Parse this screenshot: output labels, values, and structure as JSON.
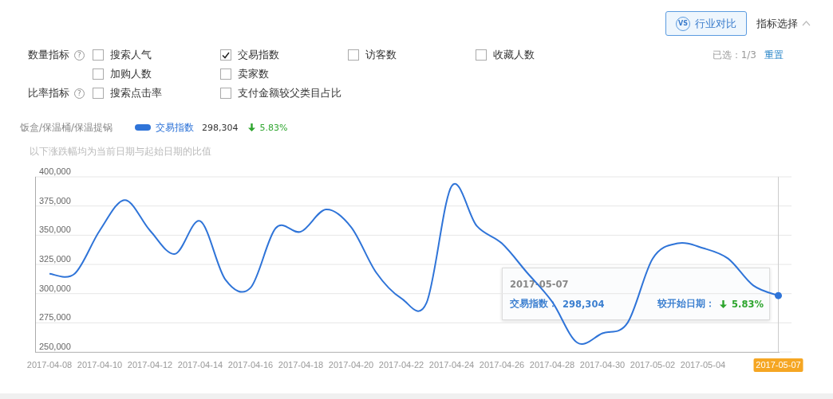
{
  "toolbar": {
    "compare_button": {
      "badge": "VS",
      "label": "行业对比"
    },
    "metric_toggle": {
      "label": "指标选择",
      "expanded": true
    }
  },
  "metric_groups": [
    {
      "label": "数量指标",
      "help": "?",
      "items": [
        {
          "label": "搜索人气",
          "checked": false
        },
        {
          "label": "交易指数",
          "checked": true
        },
        {
          "label": "访客数",
          "checked": false
        },
        {
          "label": "收藏人数",
          "checked": false
        },
        {
          "label": "加购人数",
          "checked": false
        },
        {
          "label": "卖家数",
          "checked": false
        }
      ]
    },
    {
      "label": "比率指标",
      "help": "?",
      "items": [
        {
          "label": "搜索点击率",
          "checked": false
        },
        {
          "label": "支付金额较父类目占比",
          "checked": false
        }
      ]
    }
  ],
  "selection": {
    "count": "已选：1/3",
    "reset": "重置"
  },
  "legend": {
    "category": "饭盒/保温桶/保温提锅",
    "value": "298,304",
    "change": "5.83%",
    "falling": true
  },
  "note": "以下涨跌幅均为当前日期与起始日期的比值",
  "chart_data": {
    "type": "line",
    "categories": [
      "2017-04-08",
      null,
      "2017-04-10",
      null,
      "2017-04-12",
      null,
      "2017-04-14",
      null,
      "2017-04-16",
      null,
      "2017-04-18",
      null,
      "2017-04-20",
      null,
      "2017-04-22",
      null,
      "2017-04-24",
      null,
      "2017-04-26",
      null,
      "2017-04-28",
      null,
      "2017-04-30",
      null,
      "2017-05-02",
      null,
      "2017-05-04",
      null,
      null,
      "2017-05-07"
    ],
    "grid": true,
    "series": [
      {
        "name": "交易指数",
        "color": "#2f74d8",
        "values": [
          317000,
          317000,
          354000,
          380000,
          354000,
          334000,
          362000,
          312000,
          305000,
          356000,
          353000,
          372000,
          357000,
          318000,
          296000,
          292000,
          392000,
          358000,
          343000,
          318000,
          293000,
          258000,
          266000,
          275000,
          330000,
          343000,
          339000,
          330000,
          307000,
          298304
        ]
      }
    ],
    "ylim": [
      250000,
      400000
    ],
    "yticks": [
      {
        "value": 250000,
        "label": "250,000"
      },
      {
        "value": 275000,
        "label": "275,000"
      },
      {
        "value": 300000,
        "label": "300,000"
      },
      {
        "value": 325000,
        "label": "325,000"
      },
      {
        "value": 350000,
        "label": "350,000"
      },
      {
        "value": 375000,
        "label": "375,000"
      },
      {
        "value": 400000,
        "label": "400,000"
      }
    ],
    "xlabel": null
  },
  "tooltip": {
    "date": "2017-05-07",
    "metric_label": "交易指数：",
    "metric_value": "298,304",
    "change_label": "较开始日期：",
    "change": "5.83%",
    "falling": true
  }
}
